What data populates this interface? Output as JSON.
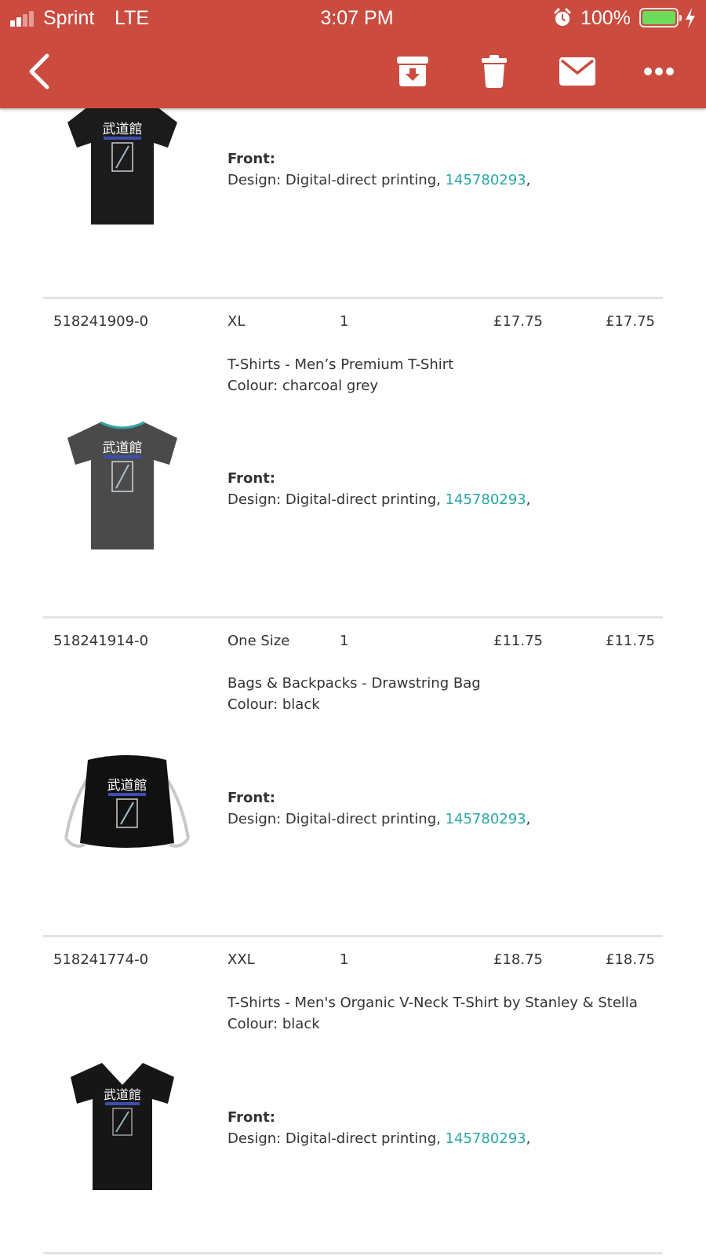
{
  "status_bar": {
    "carrier": "Sprint",
    "network": "LTE",
    "time": "3:07 PM",
    "battery": "100%",
    "battery_level": 1.0,
    "signal_bars": 2,
    "signal_bars_total": 4
  },
  "toolbar": {
    "icons": [
      "back-icon",
      "archive-icon",
      "trash-icon",
      "mail-icon",
      "more-icon"
    ]
  },
  "colors": {
    "accent": "#cb4b3f",
    "link": "#2aa6a6",
    "text": "#333333",
    "divider": "#e3e3e3",
    "battery_fill": "#6ddc5c"
  },
  "items": [
    {
      "id": "",
      "size": "",
      "qty": "",
      "unit_price": "",
      "total": "",
      "product": "",
      "colour": "",
      "front_label": "Front:",
      "design_label": "Design: Digital-direct printing, ",
      "design_id": "145780293",
      "design_suffix": ",",
      "image": "tshirt-vneck-black"
    },
    {
      "id": "518241909-0",
      "size": "XL",
      "qty": "1",
      "unit_price": "£17.75",
      "total": "£17.75",
      "product": "T-Shirts - Men’s Premium T-Shirt",
      "colour": "Colour: charcoal grey",
      "front_label": "Front:",
      "design_label": "Design: Digital-direct printing, ",
      "design_id": "145780293",
      "design_suffix": ",",
      "image": "tshirt-charcoal"
    },
    {
      "id": "518241914-0",
      "size": "One Size",
      "qty": "1",
      "unit_price": "£11.75",
      "total": "£11.75",
      "product": "Bags & Backpacks - Drawstring Bag",
      "colour": "Colour: black",
      "front_label": "Front:",
      "design_label": "Design: Digital-direct printing, ",
      "design_id": "145780293",
      "design_suffix": ",",
      "image": "drawstring-bag-black"
    },
    {
      "id": "518241774-0",
      "size": "XXL",
      "qty": "1",
      "unit_price": "£18.75",
      "total": "£18.75",
      "product": "T-Shirts - Men's Organic V-Neck T-Shirt by Stanley & Stella",
      "colour": "Colour: black",
      "front_label": "Front:",
      "design_label": "Design: Digital-direct printing, ",
      "design_id": "145780293",
      "design_suffix": ",",
      "image": "tshirt-vneck-black"
    }
  ]
}
